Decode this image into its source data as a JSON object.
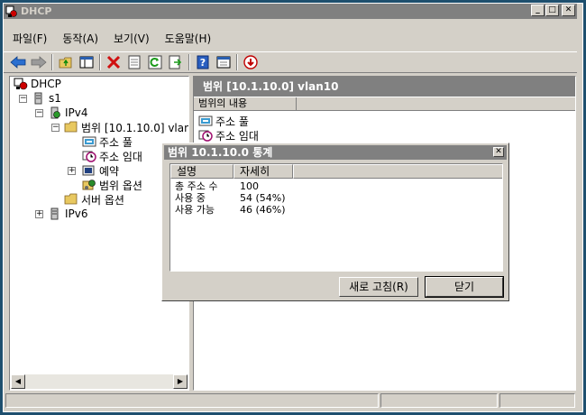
{
  "window": {
    "title": "DHCP"
  },
  "menu": [
    "파일(F)",
    "동작(A)",
    "보기(V)",
    "도움말(H)"
  ],
  "tree": {
    "root": "DHCP",
    "server": "s1",
    "ipv4": "IPv4",
    "scope": "범위 [10.1.10.0] vlan",
    "address_pool": "주소 풀",
    "address_leases": "주소 임대",
    "reservations": "예약",
    "scope_options": "범위 옵션",
    "server_options": "서버 옵션",
    "ipv6": "IPv6"
  },
  "details": {
    "header": "범위 [10.1.10.0] vlan10",
    "column": "범위의 내용",
    "items": [
      "주소 풀",
      "주소 임대"
    ]
  },
  "dialog": {
    "title": "범위 10.1.10.0 통계",
    "col_desc": "설명",
    "col_detail": "자세히",
    "rows": [
      {
        "label": "총 주소 수",
        "value": "100"
      },
      {
        "label": "사용 중",
        "value": "54 (54%)"
      },
      {
        "label": "사용 가능",
        "value": "46 (46%)"
      }
    ],
    "refresh_label": "새로 고침(R)",
    "close_label": "닫기"
  }
}
